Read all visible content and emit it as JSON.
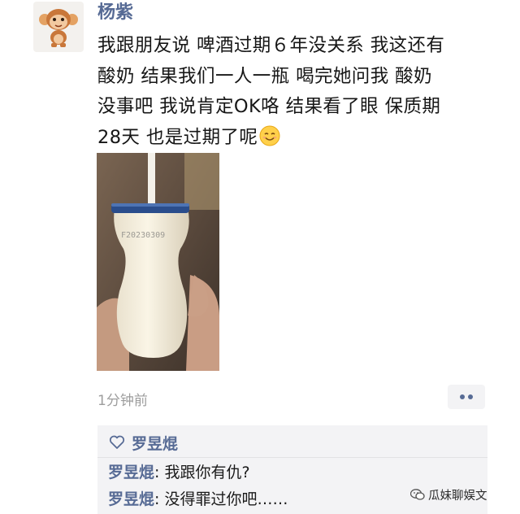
{
  "post": {
    "author": "杨紫",
    "text_lines": [
      "我跟朋友说 啤酒过期６年没关系 我这还有",
      "酸奶 结果我们一人一瓶 喝完她问我 酸奶",
      "没事吧 我说肯定OK咯 结果看了眼 保质期",
      " 28天 也是过期了呢"
    ],
    "bottle_print": "F20230309",
    "time": "1分钟前"
  },
  "likes": {
    "name": "罗昱焜"
  },
  "comments": [
    {
      "name": "罗昱焜",
      "text": ": 我跟你有仇?"
    },
    {
      "name": "罗昱焜",
      "text": ": 没得罪过你吧……"
    }
  ],
  "watermark": {
    "text": "瓜妹聊娱文"
  },
  "colors": {
    "name_blue": "#576b95",
    "panel_gray": "#f3f3f5",
    "time_gray": "#9d9d9d"
  },
  "icons": {
    "avatar": "monkey-avatar-icon",
    "emoji": "smile-emoji-icon",
    "like": "heart-outline-icon",
    "more": "two-dots-icon"
  }
}
